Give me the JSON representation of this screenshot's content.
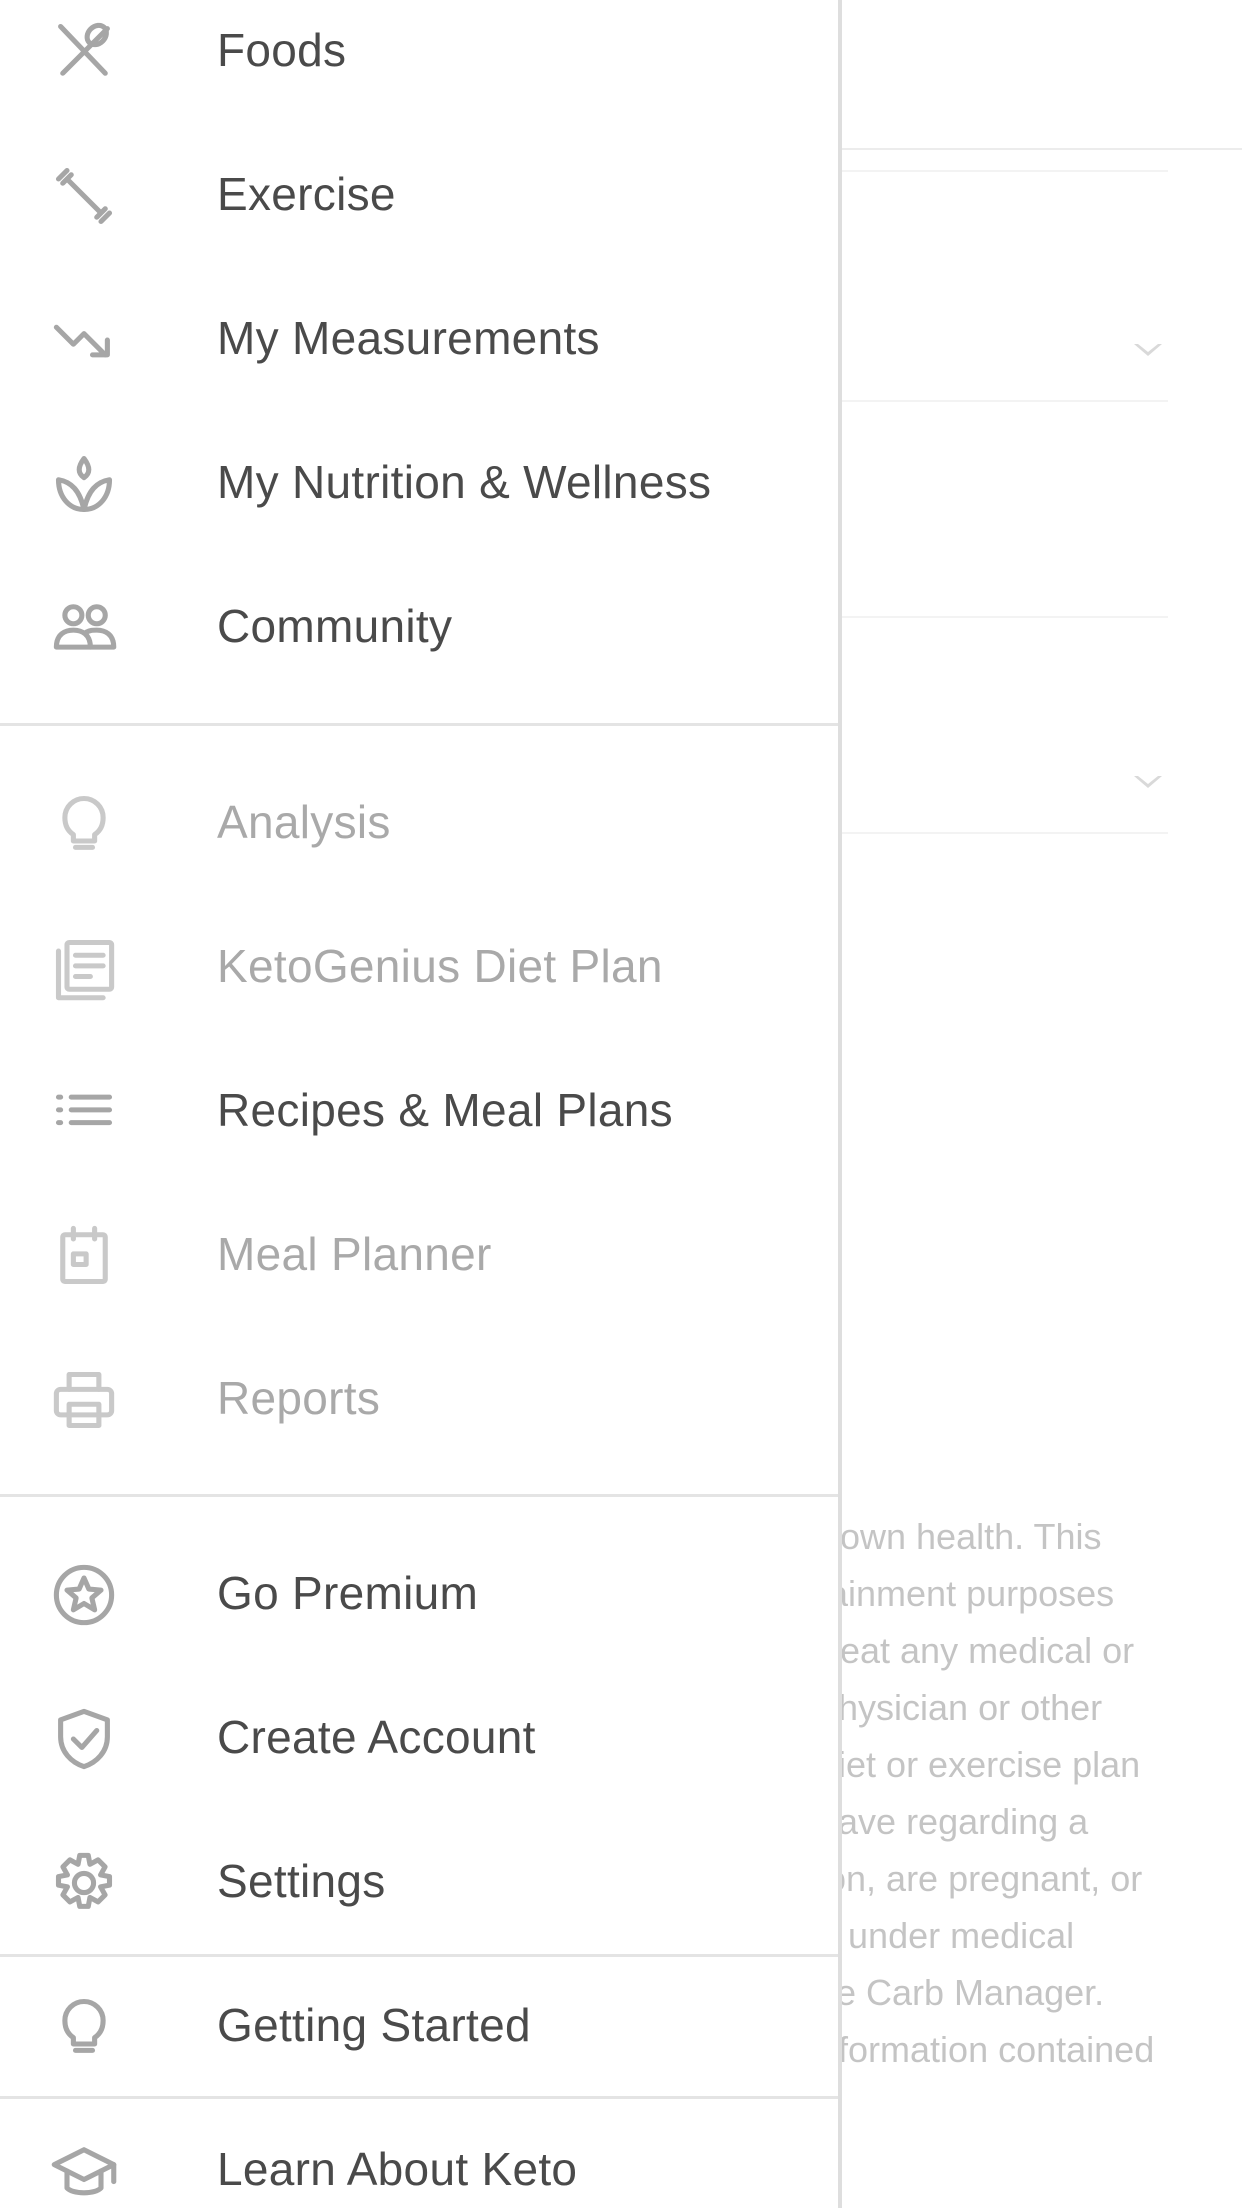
{
  "drawer": {
    "section_main": [
      {
        "label": "Foods",
        "icon": "fork-spoon-icon"
      },
      {
        "label": "Exercise",
        "icon": "dumbbell-icon"
      },
      {
        "label": "My Measurements",
        "icon": "trend-down-icon"
      },
      {
        "label": "My Nutrition & Wellness",
        "icon": "lotus-icon"
      },
      {
        "label": "Community",
        "icon": "people-icon"
      }
    ],
    "section_premium": [
      {
        "label": "Analysis",
        "icon": "lightbulb-icon"
      },
      {
        "label": "KetoGenius Diet Plan",
        "icon": "document-icon"
      },
      {
        "label": "Recipes & Meal Plans",
        "icon": "list-icon"
      },
      {
        "label": "Meal Planner",
        "icon": "calendar-icon"
      },
      {
        "label": "Reports",
        "icon": "printer-icon"
      }
    ],
    "section_account": [
      {
        "label": "Go Premium",
        "icon": "star-circle-icon"
      },
      {
        "label": "Create Account",
        "icon": "shield-check-icon"
      },
      {
        "label": "Settings",
        "icon": "gear-icon"
      }
    ],
    "section_help": [
      {
        "label": "Getting Started",
        "icon": "lightbulb-icon"
      },
      {
        "label": "Learn About Keto",
        "icon": "graduation-cap-icon"
      }
    ]
  },
  "background": {
    "disclaimer": "r own health. This\ntainment purposes\n treat any medical or\n physician or other\ndiet or exercise plan\nhave regarding a\nion, are pregnant, or\nn under medical\nse Carb Manager.\nnformation contained"
  },
  "colors": {
    "label_active": "#4a4a4a",
    "label_disabled": "#a9a9a9",
    "icon": "#a6a6a6",
    "divider": "#e4e4e4"
  }
}
